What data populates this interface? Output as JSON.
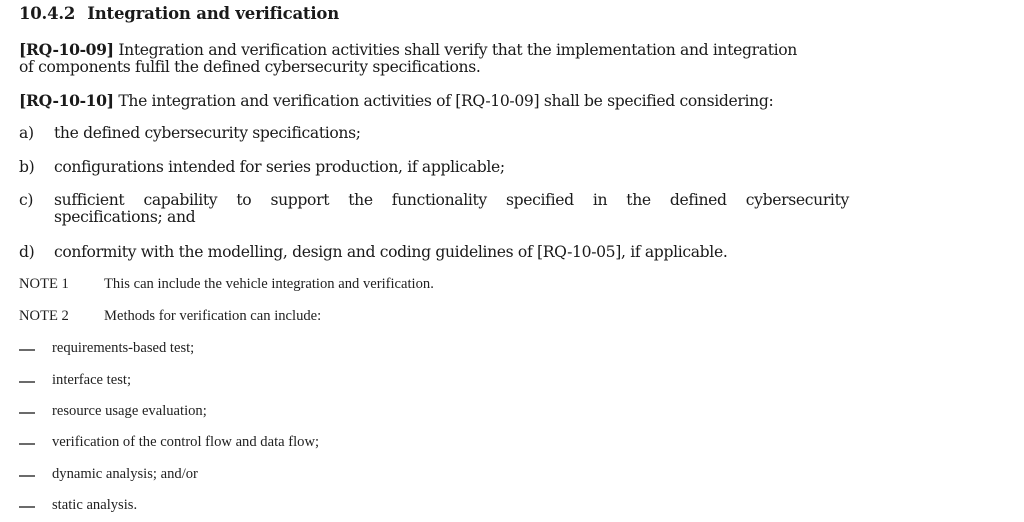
{
  "section": {
    "number": "10.4.2",
    "title": "Integration and verification"
  },
  "requirements": [
    {
      "id": "[RQ-10-09]",
      "text_line1": " Integration and verification activities shall verify that the implementation and integration",
      "text_line2": "of components fulfil the defined cybersecurity specifications."
    },
    {
      "id": "[RQ-10-10]",
      "text_line1": " The integration and verification activities of [RQ-10-09] shall be specified considering:"
    }
  ],
  "items": [
    {
      "label": "a)",
      "text": "the defined cybersecurity specifications;"
    },
    {
      "label": "b)",
      "text": "configurations intended for series production, if applicable;"
    },
    {
      "label": "c)",
      "text_line1": "sufficient capability to support the functionality specified in the defined cybersecurity",
      "text_line2": "specifications; and"
    },
    {
      "label": "d)",
      "text": "conformity with the modelling, design and coding guidelines of [RQ-10-05], if applicable."
    }
  ],
  "notes": [
    {
      "label": "NOTE 1",
      "text": "This can include the vehicle integration and verification."
    },
    {
      "label": "NOTE 2",
      "text": "Methods for verification can include:"
    }
  ],
  "methods": [
    "requirements-based test;",
    "interface test;",
    "resource usage evaluation;",
    "verification of the control flow and data flow;",
    "dynamic analysis; and/or",
    "static analysis."
  ]
}
